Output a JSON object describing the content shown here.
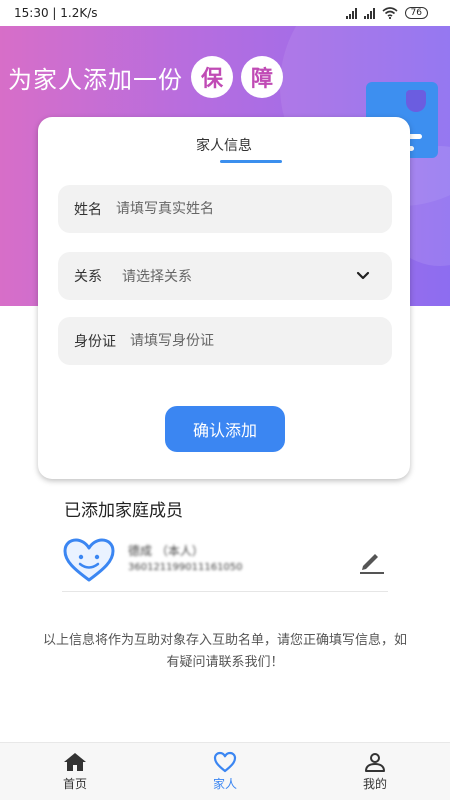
{
  "status_bar": {
    "time_speed": "15:30 | 1.2K/s",
    "battery": "76"
  },
  "hero": {
    "title_text": "为家人添加一份",
    "badge1": "保",
    "badge2": "障"
  },
  "form": {
    "tab_label": "家人信息",
    "name_label": "姓名",
    "name_placeholder": "请填写真实姓名",
    "relation_label": "关系",
    "relation_value": "请选择关系",
    "id_label": "身份证",
    "id_placeholder": "请填写身份证",
    "confirm_label": "确认添加"
  },
  "members": {
    "title": "已添加家庭成员",
    "items": [
      {
        "name": "德成 （本人）",
        "id_number": "360121199011161050"
      }
    ]
  },
  "notice": "以上信息将作为互助对象存入互助名单，请您正确填写信息，如有疑问请联系我们！",
  "nav": {
    "home": "首页",
    "family": "家人",
    "mine": "我的"
  },
  "colors": {
    "accent": "#3b86f2",
    "hero_start": "#d76ec8",
    "hero_end": "#8d6df0"
  }
}
